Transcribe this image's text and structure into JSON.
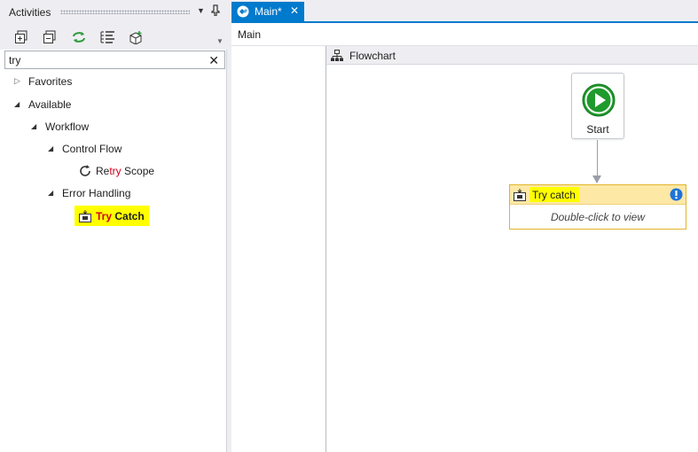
{
  "activities": {
    "title": "Activities",
    "search_value": "try",
    "clear_icon": "close-icon",
    "toolbar": [
      "expand-all-icon",
      "collapse-all-icon",
      "refresh-icon",
      "show-all-icon",
      "add-package-icon"
    ],
    "tree": {
      "favorites": "Favorites",
      "available": "Available",
      "workflow": "Workflow",
      "control_flow": "Control Flow",
      "retry_scope": {
        "prefix": "Re",
        "match": "try",
        "suffix": " Scope"
      },
      "error_handling": "Error Handling",
      "try_catch": {
        "match": "Try",
        "suffix": " Catch"
      }
    }
  },
  "document": {
    "tab_label": "Main*",
    "breadcrumb": "Main",
    "flowchart_title": "Flowchart",
    "start_label": "Start",
    "try_node": {
      "title": "Try catch",
      "body": "Double-click to view"
    }
  },
  "colors": {
    "accent": "#007acc",
    "highlight": "#ffff00",
    "start_green": "#1f9a2c",
    "match_red": "#d1001c",
    "node_header": "#fde8a6",
    "node_border": "#e0b52a"
  }
}
